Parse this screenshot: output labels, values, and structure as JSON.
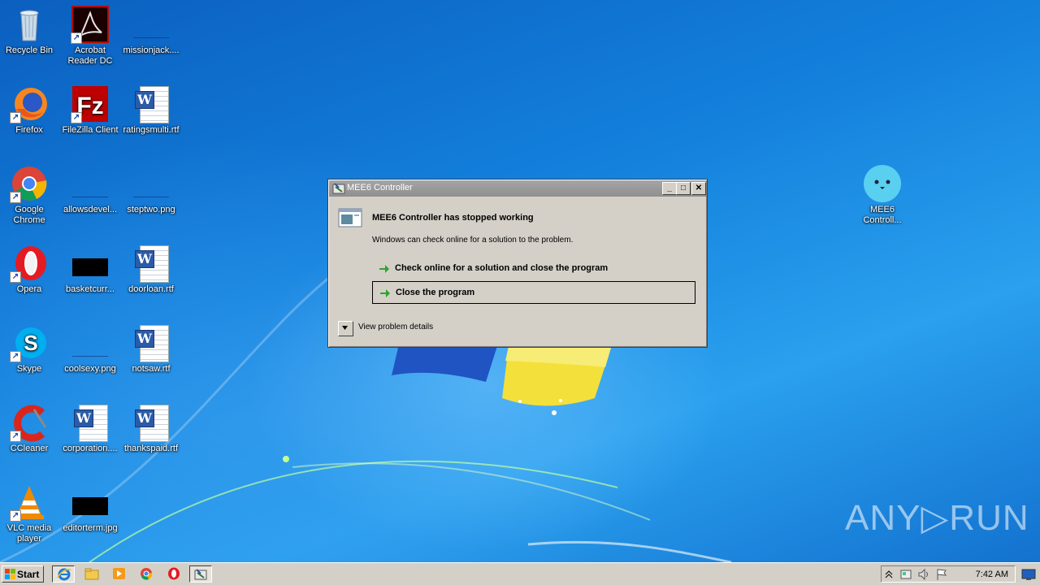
{
  "desktop": {
    "icons": [
      {
        "id": "recycle-bin",
        "label": "Recycle Bin"
      },
      {
        "id": "acrobat",
        "label": "Acrobat Reader DC"
      },
      {
        "id": "missionjack",
        "label": "missionjack...."
      },
      {
        "id": "firefox",
        "label": "Firefox"
      },
      {
        "id": "filezilla",
        "label": "FileZilla Client"
      },
      {
        "id": "ratingsmulti",
        "label": "ratingsmulti.rtf"
      },
      {
        "id": "chrome",
        "label": "Google Chrome"
      },
      {
        "id": "allowsdevel",
        "label": "allowsdevel..."
      },
      {
        "id": "steptwo",
        "label": "steptwo.png"
      },
      {
        "id": "opera",
        "label": "Opera"
      },
      {
        "id": "basketcurr",
        "label": "basketcurr..."
      },
      {
        "id": "doorloan",
        "label": "doorloan.rtf"
      },
      {
        "id": "skype",
        "label": "Skype"
      },
      {
        "id": "coolsexy",
        "label": "coolsexy.png"
      },
      {
        "id": "notsaw",
        "label": "notsaw.rtf"
      },
      {
        "id": "ccleaner",
        "label": "CCleaner"
      },
      {
        "id": "corporation",
        "label": "corporation...."
      },
      {
        "id": "thankspaid",
        "label": "thankspaid.rtf"
      },
      {
        "id": "vlc",
        "label": "VLC media player"
      },
      {
        "id": "editorterm",
        "label": "editorterm.jpg"
      },
      {
        "id": "mee6",
        "label": "MEE6 Controll..."
      }
    ]
  },
  "dialog": {
    "title": "MEE6 Controller",
    "heading": "MEE6 Controller has stopped working",
    "subtext": "Windows can check online for a solution to the problem.",
    "option_check_online": "Check online for a solution and close the program",
    "option_close": "Close the program",
    "details_label": "View problem details",
    "minimize": "_",
    "maximize": "□",
    "close": "✕"
  },
  "watermark": "ANY▷RUN",
  "taskbar": {
    "start_label": "Start",
    "clock": "7:42 AM",
    "colors": {
      "face": "#d4d0c8",
      "highlight": "#ffffff",
      "shadow": "#404040"
    }
  }
}
